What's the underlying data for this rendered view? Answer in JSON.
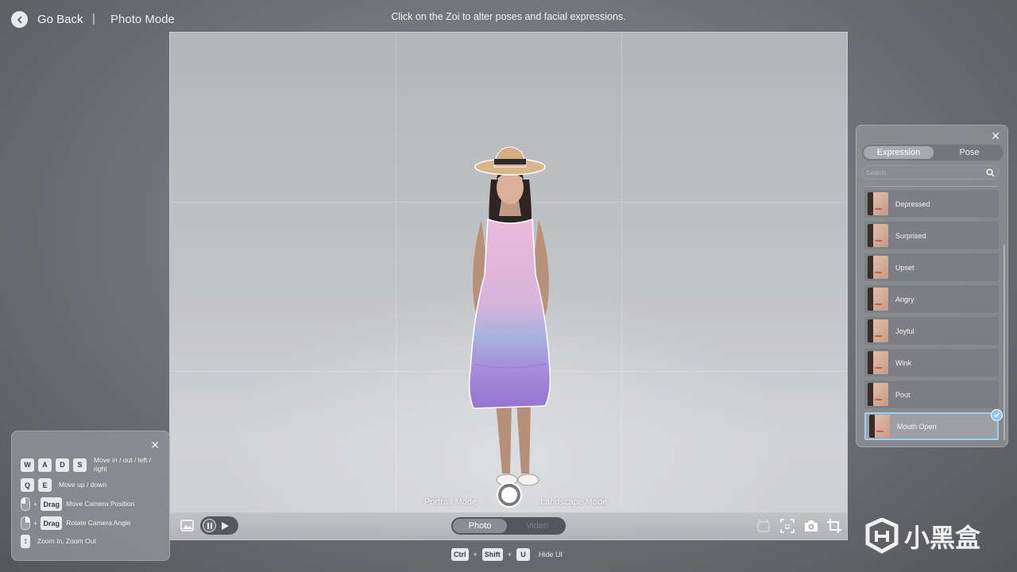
{
  "header": {
    "back_label": "Go Back",
    "separator": "|",
    "mode_title": "Photo Mode",
    "hint": "Click on the Zoi to alter poses and facial expressions."
  },
  "viewport": {
    "portrait_label": "Portrait Mode",
    "landscape_label": "Landscape Mode",
    "modes": {
      "photo": "Photo",
      "video": "Video",
      "selected": "Photo"
    }
  },
  "expression_panel": {
    "tabs": [
      {
        "label": "Expression",
        "active": true
      },
      {
        "label": "Pose",
        "active": false
      }
    ],
    "search_placeholder": "Search",
    "items": [
      {
        "label": "Depressed",
        "selected": false
      },
      {
        "label": "Surprised",
        "selected": false
      },
      {
        "label": "Upset",
        "selected": false
      },
      {
        "label": "Angry",
        "selected": false
      },
      {
        "label": "Joyful",
        "selected": false
      },
      {
        "label": "Wink",
        "selected": false
      },
      {
        "label": "Pout",
        "selected": false
      },
      {
        "label": "Mouth Open",
        "selected": true
      }
    ]
  },
  "controls": {
    "row1": {
      "keys": [
        "W",
        "A",
        "D",
        "S"
      ],
      "text": "Move in / out / left / right"
    },
    "row2": {
      "keys": [
        "Q",
        "E"
      ],
      "text": "Move up / down"
    },
    "row3": {
      "key": "Drag",
      "text": "Move Camera Position"
    },
    "row4": {
      "key": "Drag",
      "text": "Rotate Camera Angle"
    },
    "row5": {
      "text": "Zoom In, Zoom Out"
    },
    "plus": "+"
  },
  "hide_ui": {
    "keys": [
      "Ctrl",
      "Shift",
      "U"
    ],
    "plus": "+",
    "label": "Hide UI"
  },
  "watermark": {
    "text": "小黑盒"
  },
  "colors": {
    "accent_selected": "#9cd0f5",
    "check_badge": "#8ec6f3",
    "dress_top": "#e9b8d9",
    "dress_bottom": "#9c7fd6"
  }
}
